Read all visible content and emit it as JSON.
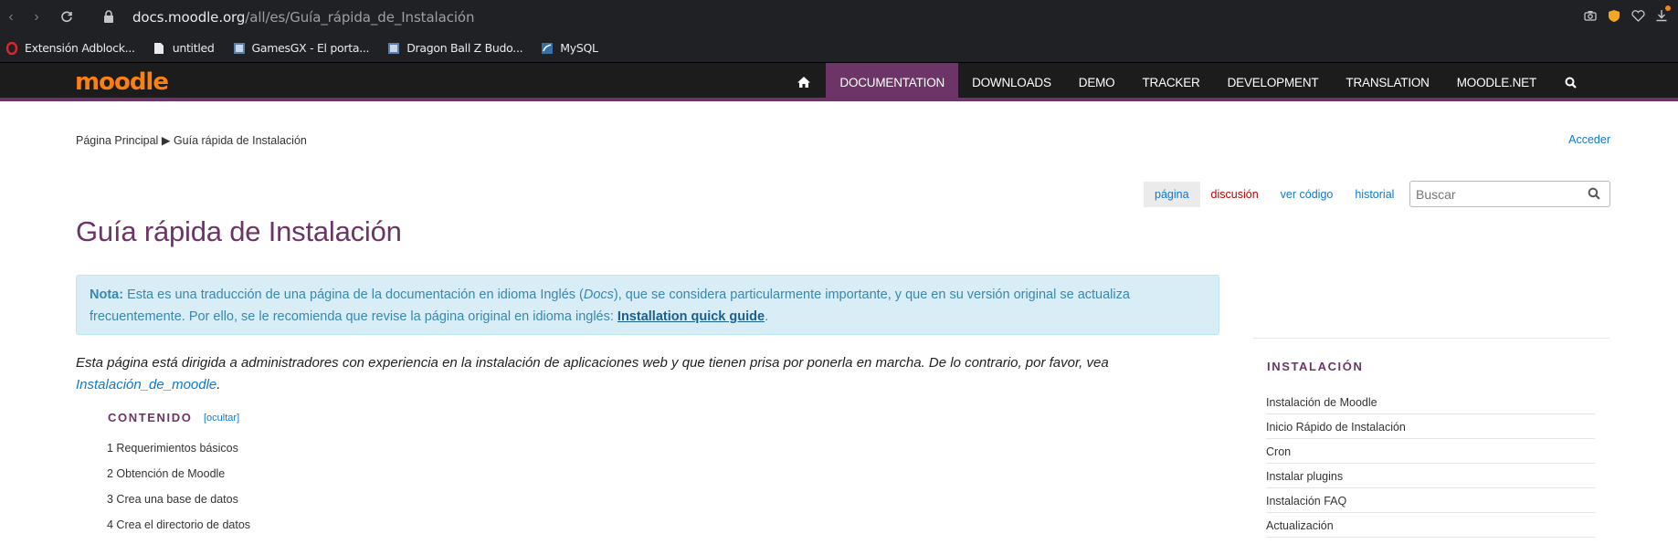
{
  "browser": {
    "url_domain": "docs.moodle.org",
    "url_path": "/all/es/Guía_rápida_de_Instalación",
    "bookmarks": [
      {
        "label": "Extensión Adblock...",
        "icon": "opera-icon"
      },
      {
        "label": "untitled",
        "icon": "document-icon"
      },
      {
        "label": "GamesGX - El porta...",
        "icon": "site-icon"
      },
      {
        "label": "Dragon Ball Z Budo...",
        "icon": "site-icon"
      },
      {
        "label": "MySQL",
        "icon": "mysql-icon"
      }
    ]
  },
  "site": {
    "logo": "moodle",
    "nav": [
      "DOCUMENTATION",
      "DOWNLOADS",
      "DEMO",
      "TRACKER",
      "DEVELOPMENT",
      "TRANSLATION",
      "MOODLE.NET"
    ],
    "active_nav": "DOCUMENTATION"
  },
  "page": {
    "breadcrumb_home": "Página Principal",
    "breadcrumb_sep": "▶",
    "breadcrumb_current": "Guía rápida de Instalación",
    "login": "Acceder",
    "tabs": {
      "page": "página",
      "discussion": "discusión",
      "view_source": "ver código",
      "history": "historial"
    },
    "search_placeholder": "Buscar",
    "title": "Guía rápida de Instalación",
    "note": {
      "label": "Nota:",
      "text1": " Esta es una traducción de una página de la documentación en idioma Inglés (",
      "docs": "Docs",
      "text2": "), que se considera particularmente importante, y que en su versión original se actualiza frecuentemente. Por ello, se le recomienda que revise la página original en idioma inglés: ",
      "link": "Installation quick guide",
      "end": "."
    },
    "intro_text": "Esta página está dirigida a administradores con experiencia en la instalación de aplicaciones web y que tienen prisa por ponerla en marcha. De lo contrario, por favor, vea ",
    "intro_link": "Instalación_de_moodle",
    "intro_end": ".",
    "toc_title": "CONTENIDO",
    "toc_hide": "[ocultar]",
    "toc": [
      "1 Requerimientos básicos",
      "2 Obtención de Moodle",
      "3 Crea una base de datos",
      "4 Crea el directorio de datos"
    ]
  },
  "sidebar": {
    "title": "INSTALACIÓN",
    "items": [
      "Instalación de Moodle",
      "Inicio Rápido de Instalación",
      "Cron",
      "Instalar plugins",
      "Instalación FAQ",
      "Actualización"
    ]
  },
  "colors": {
    "brand": "#f98012",
    "purple": "#6d3567",
    "link": "#1177d1",
    "note_bg": "#d9edf7"
  }
}
